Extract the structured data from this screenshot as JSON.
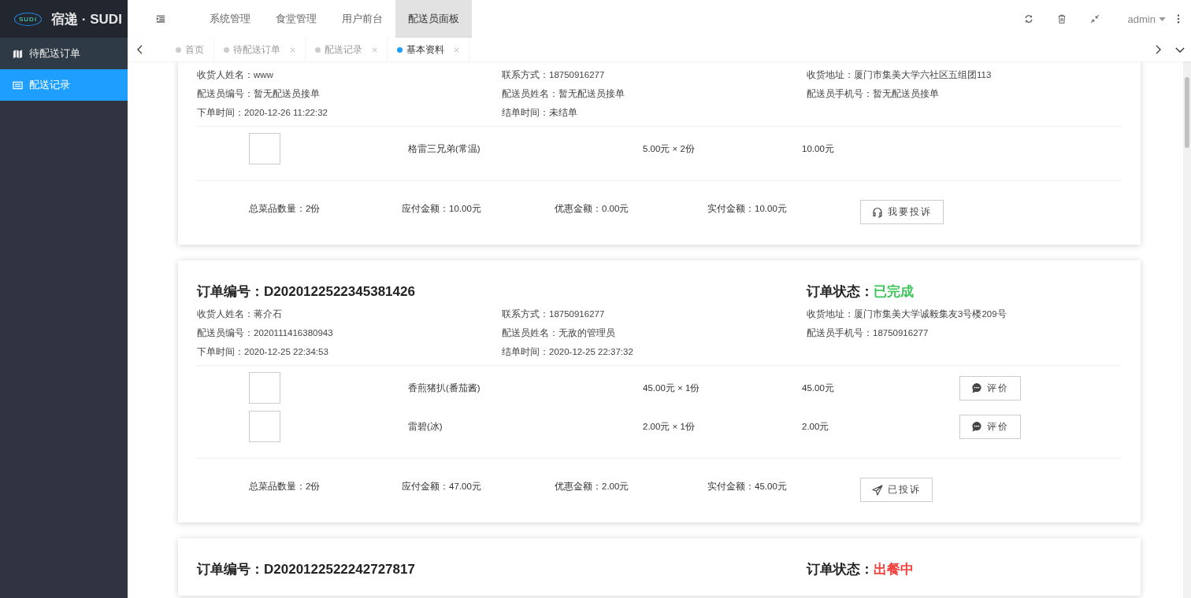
{
  "brand": {
    "logo": "SUDI",
    "title": "宿递 · SUDI"
  },
  "sidebar": {
    "items": [
      {
        "label": "待配送订单",
        "selected": false
      },
      {
        "label": "配送记录",
        "selected": true
      }
    ]
  },
  "topnav": {
    "items": [
      {
        "label": "系统管理",
        "selected": false
      },
      {
        "label": "食堂管理",
        "selected": false
      },
      {
        "label": "用户前台",
        "selected": false
      },
      {
        "label": "配送员面板",
        "selected": true
      }
    ],
    "user": "admin"
  },
  "tabs": [
    {
      "label": "首页",
      "selected": false,
      "closable": false
    },
    {
      "label": "待配送订单",
      "selected": false,
      "closable": true
    },
    {
      "label": "配送记录",
      "selected": false,
      "closable": true
    },
    {
      "label": "基本资料",
      "selected": true,
      "closable": true
    }
  ],
  "orders": [
    {
      "info": [
        {
          "label": "收货人姓名：",
          "value": "www"
        },
        {
          "label": "联系方式：",
          "value": "18750916277"
        },
        {
          "label": "收货地址：",
          "value": "厦门市集美大学六社区五组团113"
        },
        {
          "label": "配送员编号：",
          "value": "暂无配送员接单"
        },
        {
          "label": "配送员姓名：",
          "value": "暂无配送员接单"
        },
        {
          "label": "配送员手机号：",
          "value": "暂无配送员接单"
        },
        {
          "label": "下单时间：",
          "value": "2020-12-26 11:22:32"
        },
        {
          "label": "结单时间：",
          "value": "未结单"
        }
      ],
      "items": [
        {
          "name": "格雷三兄弟(常温)",
          "price": "5.00元 × 2份",
          "subtotal": "10.00元"
        }
      ],
      "totals": [
        {
          "label": "总菜品数量：",
          "value": "2份"
        },
        {
          "label": "应付金额：",
          "value": "10.00元"
        },
        {
          "label": "优惠金额：",
          "value": "0.00元"
        },
        {
          "label": "实付金额：",
          "value": "10.00元"
        }
      ],
      "action": {
        "kind": "complain",
        "label": "我要投诉"
      }
    },
    {
      "number_label": "订单编号：",
      "number": "D2020122522345381426",
      "status_label": "订单状态：",
      "status": "已完成",
      "color": "#3ec65b",
      "info": [
        {
          "label": "收货人姓名：",
          "value": "蒋介石"
        },
        {
          "label": "联系方式：",
          "value": "18750916277"
        },
        {
          "label": "收货地址：",
          "value": "厦门市集美大学诚毅集友3号楼209号"
        },
        {
          "label": "配送员编号：",
          "value": "2020111416380943"
        },
        {
          "label": "配送员姓名：",
          "value": "无敌的管理员"
        },
        {
          "label": "配送员手机号：",
          "value": "18750916277"
        },
        {
          "label": "下单时间：",
          "value": "2020-12-25 22:34:53"
        },
        {
          "label": "结单时间：",
          "value": "2020-12-25 22:37:32"
        }
      ],
      "items": [
        {
          "name": "香煎猪扒(番茄酱)",
          "price": "45.00元 × 1份",
          "subtotal": "45.00元",
          "review": "评价"
        },
        {
          "name": "雷碧(冰)",
          "price": "2.00元 × 1份",
          "subtotal": "2.00元",
          "review": "评价"
        }
      ],
      "totals": [
        {
          "label": "总菜品数量：",
          "value": "2份"
        },
        {
          "label": "应付金额：",
          "value": "47.00元"
        },
        {
          "label": "优惠金额：",
          "value": "2.00元"
        },
        {
          "label": "实付金额：",
          "value": "45.00元"
        }
      ],
      "action": {
        "kind": "complained",
        "label": "已投诉"
      }
    },
    {
      "number_label": "订单编号：",
      "number": "D2020122522242727817",
      "status_label": "订单状态：",
      "status": "出餐中",
      "color": "#f0413c"
    }
  ]
}
